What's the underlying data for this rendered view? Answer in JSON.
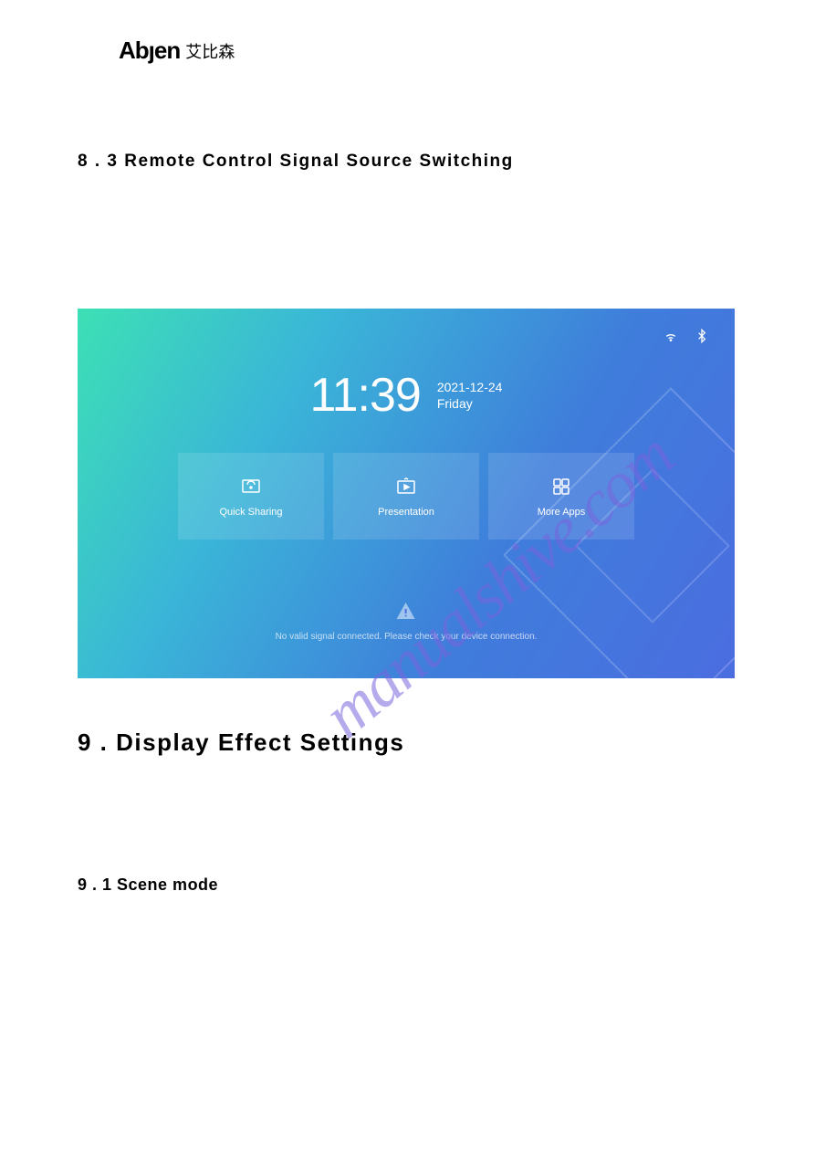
{
  "logo": {
    "brand": "Abȷen",
    "chinese": "艾比森"
  },
  "headings": {
    "section_8_3": "8 . 3   Remote  Control  Signal  Source  Switching",
    "section_9": "9 .    Display  Effect  Settings",
    "section_9_1": "9 . 1  Scene  mode"
  },
  "screenshot": {
    "time": "11:39",
    "date": "2021-12-24",
    "day": "Friday",
    "tiles": {
      "quick_sharing": "Quick Sharing",
      "presentation": "Presentation",
      "more_apps": "More Apps"
    },
    "warning": "No valid signal connected. Please check your device connection."
  },
  "watermark": "manualshive.com"
}
